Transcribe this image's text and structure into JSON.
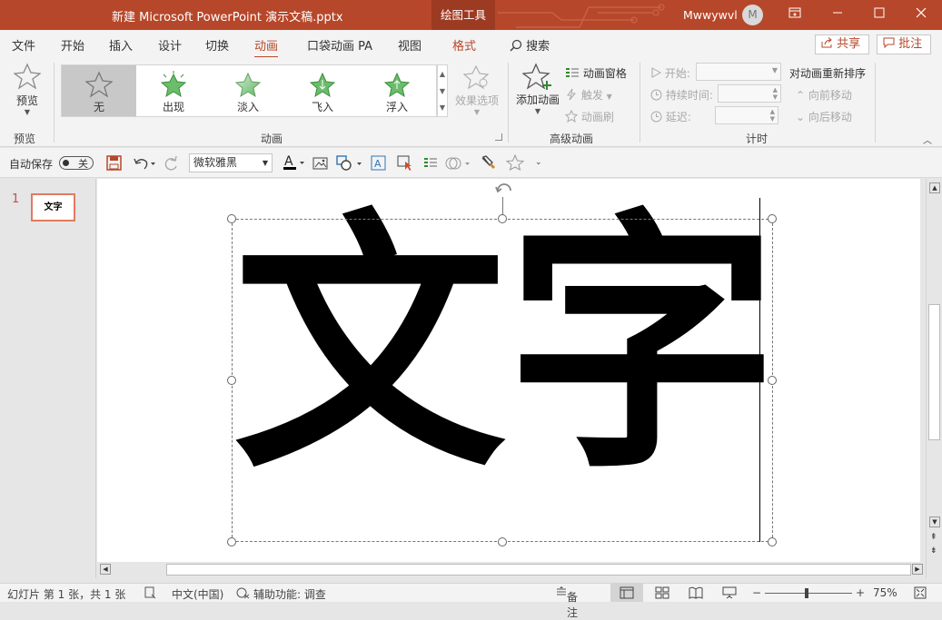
{
  "titlebar": {
    "title": "新建 Microsoft PowerPoint 演示文稿.pptx",
    "context_tab": "绘图工具",
    "user_name": "Mwwywvl",
    "avatar_initial": "M",
    "accent": "#b7472a"
  },
  "tabs": [
    "文件",
    "开始",
    "插入",
    "设计",
    "切换",
    "动画",
    "口袋动画 PA",
    "视图",
    "格式"
  ],
  "active_tab": "动画",
  "search_label": "搜索",
  "share_label": "共享",
  "comment_label": "批注",
  "ribbon": {
    "preview_label": "预览",
    "preview_group": "预览",
    "animation_group": "动画",
    "gallery": [
      "无",
      "出现",
      "淡入",
      "飞入",
      "浮入"
    ],
    "selected_animation": "无",
    "effect_options": "效果选项",
    "add_animation": "添加动画",
    "animation_pane": "动画窗格",
    "trigger": "触发",
    "animation_painter": "动画刷",
    "advanced_group": "高级动画",
    "start_label": "开始:",
    "duration_label": "持续时间:",
    "delay_label": "延迟:",
    "reorder_label": "对动画重新排序",
    "move_earlier": "向前移动",
    "move_later": "向后移动",
    "timing_group": "计时"
  },
  "qat": {
    "autosave_label": "自动保存",
    "autosave_state": "关",
    "font_name": "微软雅黑"
  },
  "slides": {
    "number": "1",
    "thumb_text": "文字"
  },
  "slide_content": {
    "text": "文字"
  },
  "status": {
    "slide_info": "幻灯片 第 1 张，共 1 张",
    "language": "中文(中国)",
    "accessibility": "辅助功能: 调查",
    "notes": "备注",
    "zoom": "75%",
    "zoom_fraction": 0.5
  }
}
